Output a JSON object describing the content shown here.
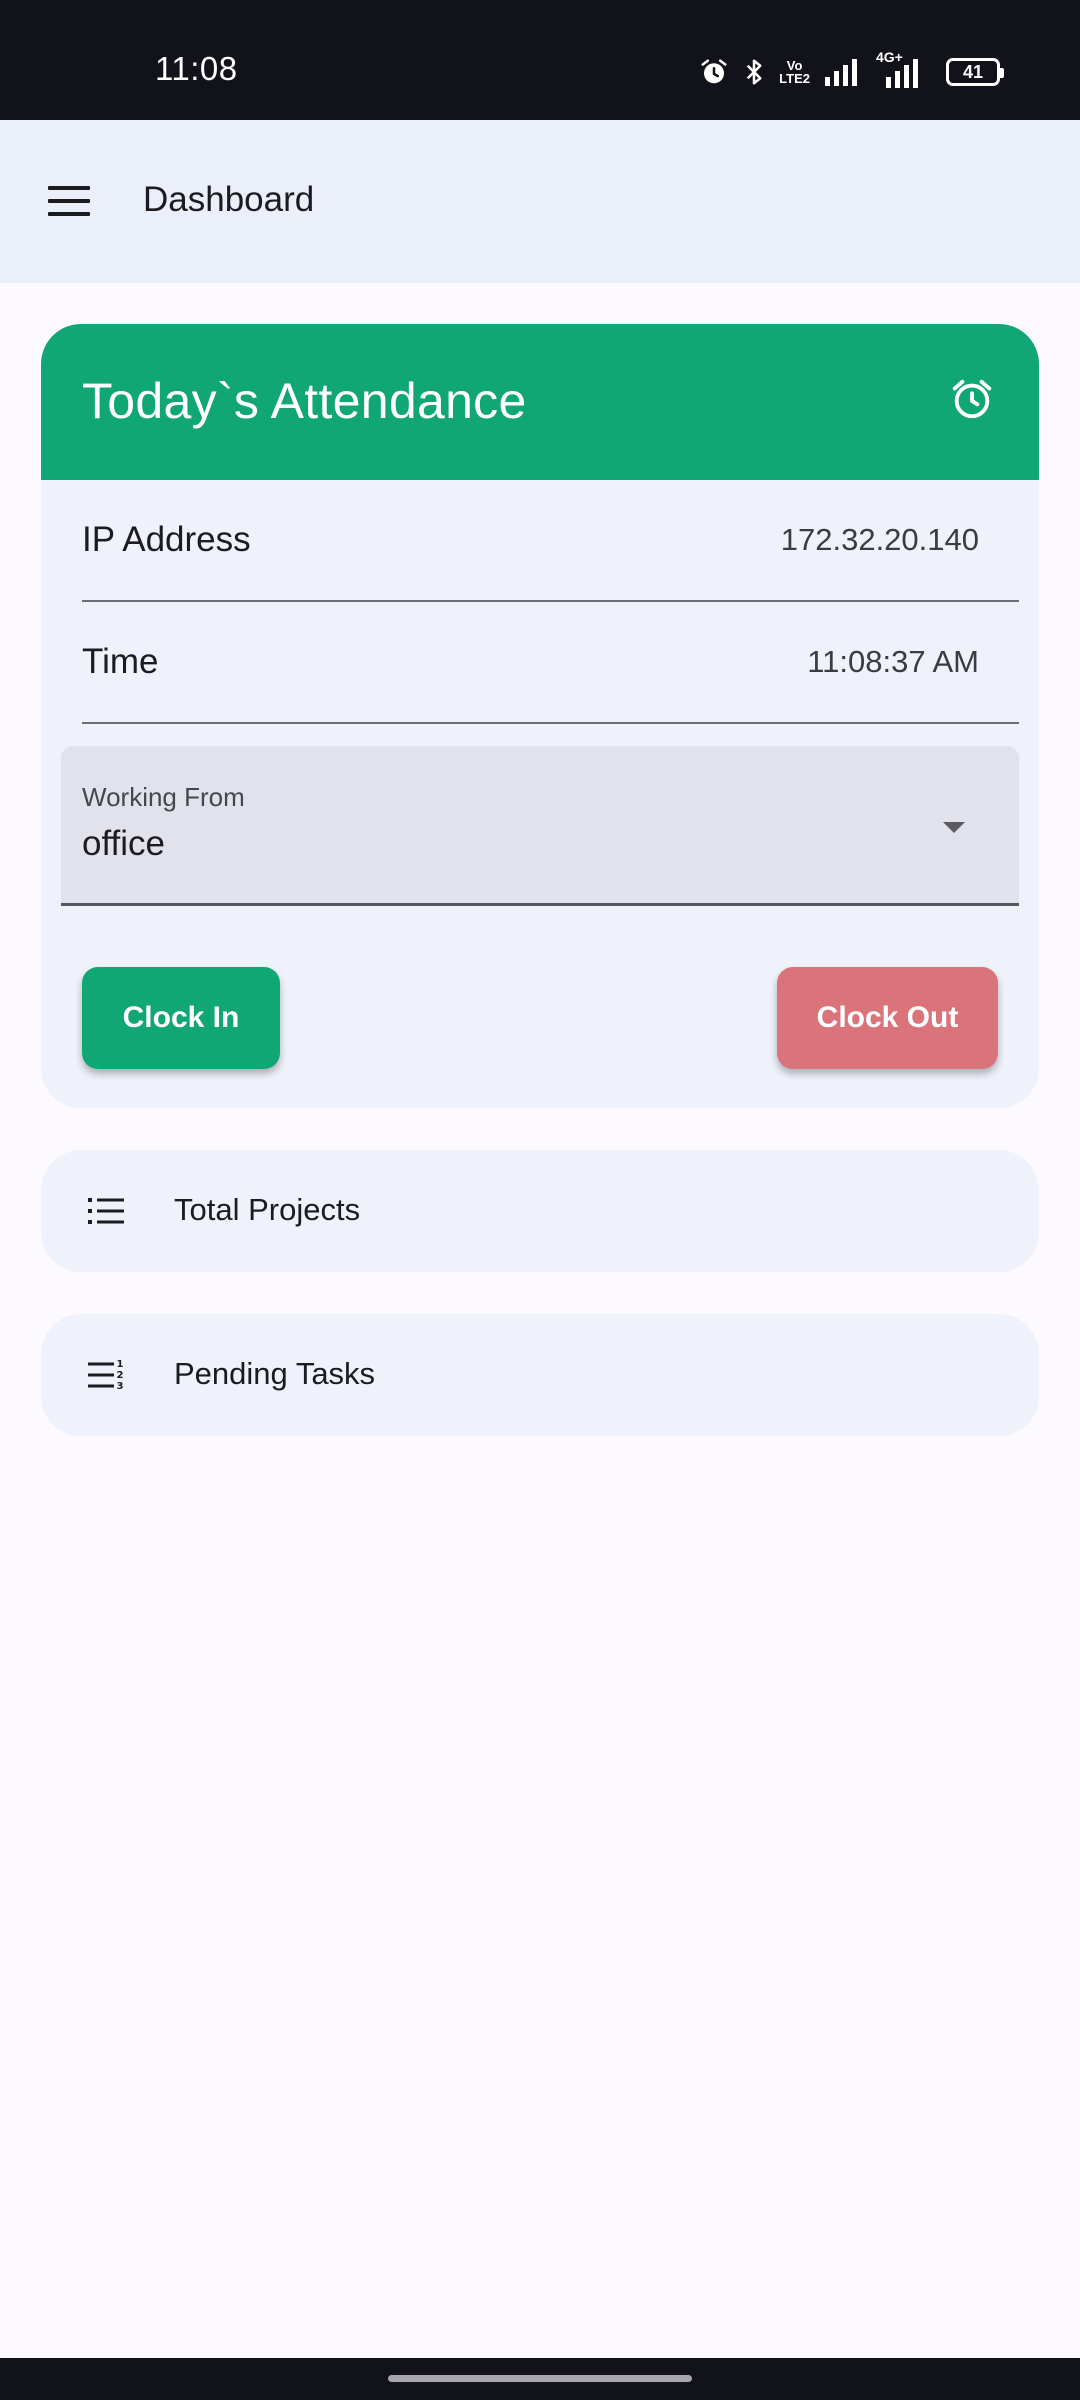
{
  "status_bar": {
    "time": "11:08",
    "network": "4G+",
    "volte_top": "Vo",
    "volte_bottom": "LTE2",
    "battery": "41"
  },
  "app_bar": {
    "title": "Dashboard"
  },
  "attendance": {
    "title": "Today`s Attendance",
    "ip_label": "IP Address",
    "ip_value": "172.32.20.140",
    "time_label": "Time",
    "time_value": "11:08:37 AM",
    "working_from_label": "Working From",
    "working_from_value": "office",
    "clock_in_label": "Clock In",
    "clock_out_label": "Clock Out"
  },
  "tiles": [
    {
      "label": "Total Projects",
      "icon": "list-icon"
    },
    {
      "label": "Pending Tasks",
      "icon": "numbered-list-icon"
    }
  ],
  "colors": {
    "primary": "#10A775",
    "danger": "#DB737A",
    "app_bar_bg": "#EAEFFA",
    "card_bg": "#EFF2FB"
  }
}
